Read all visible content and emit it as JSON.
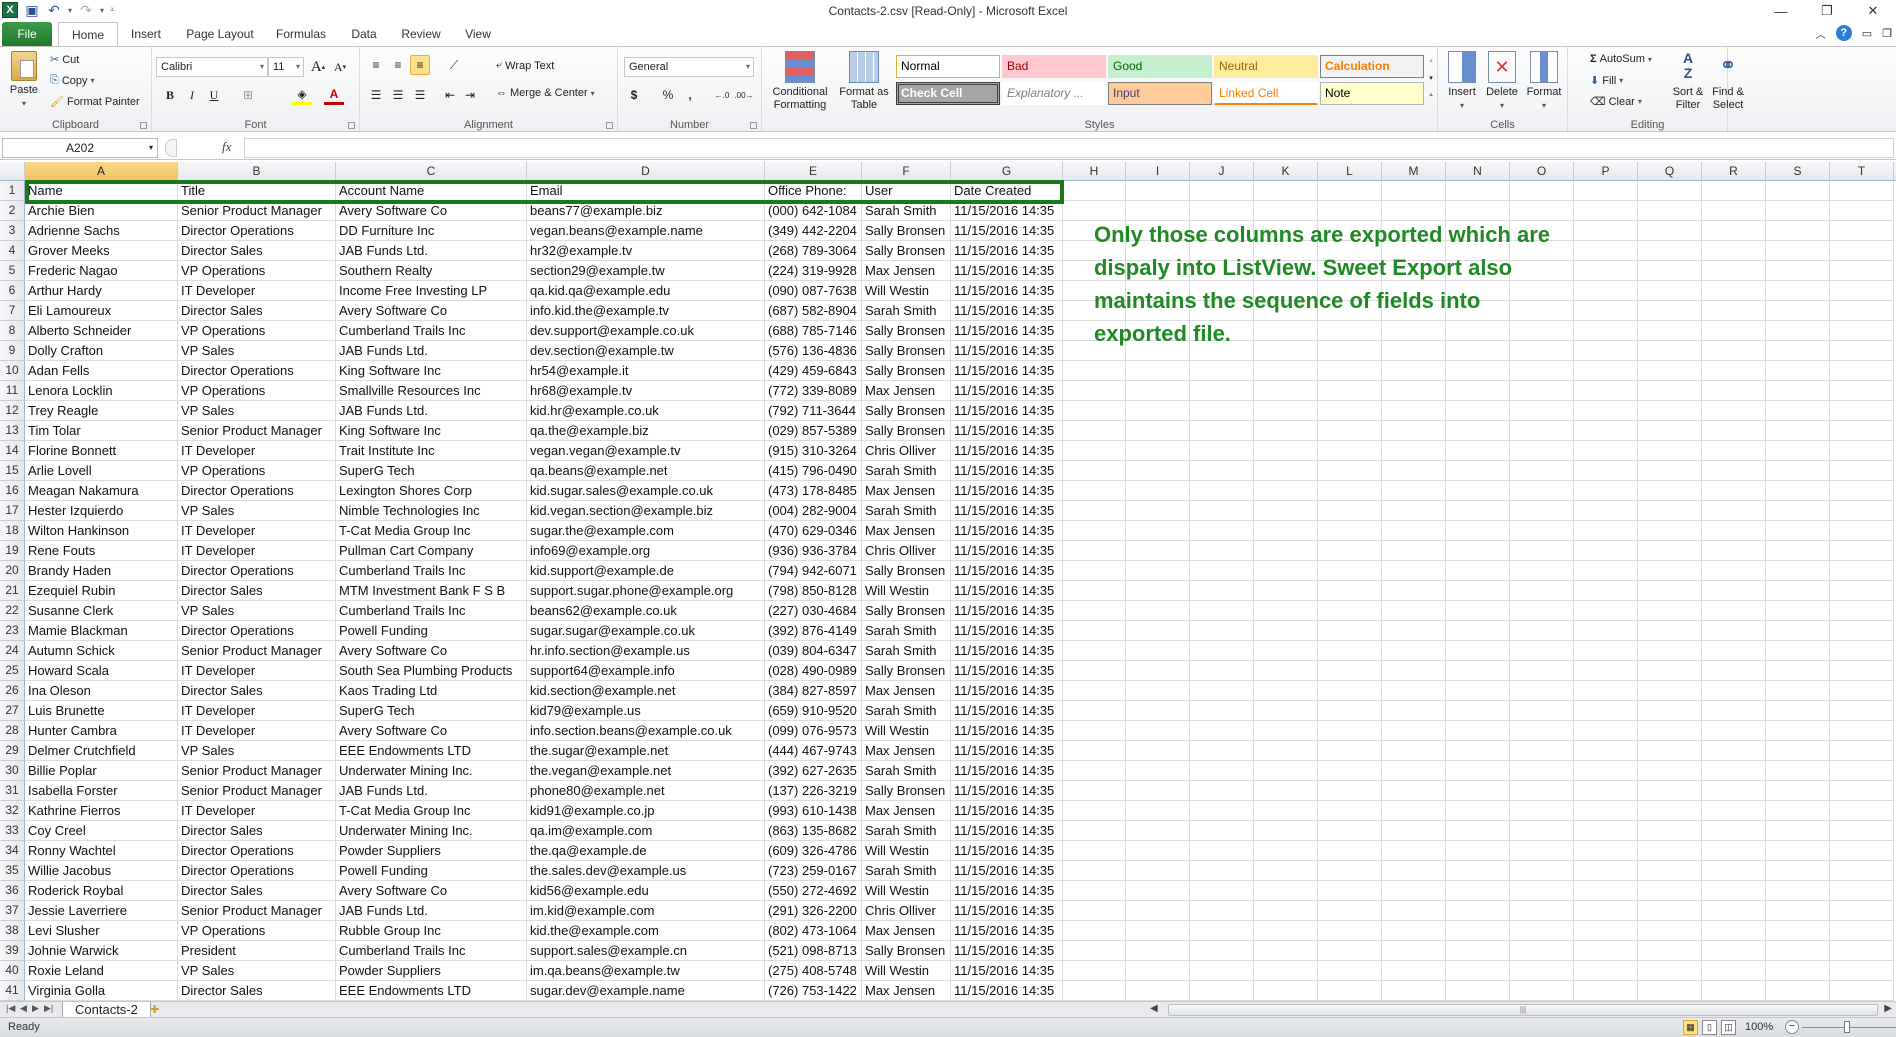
{
  "window": {
    "title": "Contacts-2.csv  [Read-Only]  -  Microsoft Excel",
    "qat": [
      "excel-logo",
      "save-icon",
      "undo-icon",
      "redo-icon",
      "customize-icon"
    ],
    "controls": {
      "minimize": "—",
      "restore": "❐",
      "close": "✕"
    }
  },
  "tabs": [
    {
      "label": "File"
    },
    {
      "label": "Home",
      "active": true
    },
    {
      "label": "Insert"
    },
    {
      "label": "Page Layout"
    },
    {
      "label": "Formulas"
    },
    {
      "label": "Data"
    },
    {
      "label": "Review"
    },
    {
      "label": "View"
    }
  ],
  "ribbon": {
    "clipboard": {
      "label": "Clipboard",
      "paste": "Paste",
      "cut": "Cut",
      "copy": "Copy",
      "format_painter": "Format Painter"
    },
    "font": {
      "label": "Font",
      "font_name": "Calibri",
      "font_size": "11",
      "bold": "B",
      "italic": "I",
      "underline": "U"
    },
    "alignment": {
      "label": "Alignment",
      "wrap_text": "Wrap Text",
      "merge_center": "Merge & Center"
    },
    "number": {
      "label": "Number",
      "format": "General",
      "currency": "$",
      "percent": "%",
      "comma": ","
    },
    "styles": {
      "label": "Styles",
      "conditional_formatting": "Conditional Formatting",
      "format_as_table": "Format as Table",
      "cells": [
        {
          "label": "Normal",
          "bg": "#ffffff",
          "fg": "#000000",
          "border": "#e3b03a"
        },
        {
          "label": "Bad",
          "bg": "#ffc7ce",
          "fg": "#9c0006"
        },
        {
          "label": "Good",
          "bg": "#c6efce",
          "fg": "#006100"
        },
        {
          "label": "Neutral",
          "bg": "#ffeb9c",
          "fg": "#9c6500"
        },
        {
          "label": "Calculation",
          "bg": "#f2f2f2",
          "fg": "#fa7d00",
          "border": "#7f7f7f"
        },
        {
          "label": "Check Cell",
          "bg": "#a5a5a5",
          "fg": "#ffffff",
          "border": "#3f3f3f"
        },
        {
          "label": "Explanatory ...",
          "bg": "#ffffff",
          "fg": "#7f7f7f"
        },
        {
          "label": "Input",
          "bg": "#ffcc99",
          "fg": "#3f3f76",
          "border": "#7f7f7f"
        },
        {
          "label": "Linked Cell",
          "bg": "#ffffff",
          "fg": "#fa7d00"
        },
        {
          "label": "Note",
          "bg": "#ffffcc",
          "fg": "#000000",
          "border": "#b2b2b2"
        }
      ]
    },
    "cells": {
      "label": "Cells",
      "insert": "Insert",
      "delete": "Delete",
      "format": "Format"
    },
    "editing": {
      "label": "Editing",
      "autosum": "AutoSum",
      "fill": "Fill",
      "clear": "Clear",
      "sort_filter": "Sort & Filter",
      "find_select": "Find & Select"
    }
  },
  "formula_bar": {
    "name_box": "A202",
    "fx": "fx",
    "value": ""
  },
  "grid": {
    "columns": [
      "A",
      "B",
      "C",
      "D",
      "E",
      "F",
      "G",
      "H",
      "I",
      "J",
      "K",
      "L",
      "M",
      "N",
      "O",
      "P",
      "Q",
      "R",
      "S",
      "T"
    ],
    "selected_column": "A",
    "header": [
      "Name",
      "Title",
      "Account Name",
      "Email",
      "Office Phone:",
      "User",
      "Date Created"
    ],
    "rows": [
      [
        "Archie Bien",
        "Senior Product Manager",
        "Avery Software Co",
        "beans77@example.biz",
        "(000) 642-1084",
        "Sarah Smith",
        "11/15/2016 14:35"
      ],
      [
        "Adrienne Sachs",
        "Director Operations",
        "DD Furniture Inc",
        "vegan.beans@example.name",
        "(349) 442-2204",
        "Sally Bronsen",
        "11/15/2016 14:35"
      ],
      [
        "Grover Meeks",
        "Director Sales",
        "JAB Funds Ltd.",
        "hr32@example.tv",
        "(268) 789-3064",
        "Sally Bronsen",
        "11/15/2016 14:35"
      ],
      [
        "Frederic Nagao",
        "VP Operations",
        "Southern Realty",
        "section29@example.tw",
        "(224) 319-9928",
        "Max Jensen",
        "11/15/2016 14:35"
      ],
      [
        "Arthur Hardy",
        "IT Developer",
        "Income Free Investing LP",
        "qa.kid.qa@example.edu",
        "(090) 087-7638",
        "Will Westin",
        "11/15/2016 14:35"
      ],
      [
        "Eli Lamoureux",
        "Director Sales",
        "Avery Software Co",
        "info.kid.the@example.tv",
        "(687) 582-8904",
        "Sarah Smith",
        "11/15/2016 14:35"
      ],
      [
        "Alberto Schneider",
        "VP Operations",
        "Cumberland Trails Inc",
        "dev.support@example.co.uk",
        "(688) 785-7146",
        "Sally Bronsen",
        "11/15/2016 14:35"
      ],
      [
        "Dolly Crafton",
        "VP Sales",
        "JAB Funds Ltd.",
        "dev.section@example.tw",
        "(576) 136-4836",
        "Sally Bronsen",
        "11/15/2016 14:35"
      ],
      [
        "Adan Fells",
        "Director Operations",
        "King Software Inc",
        "hr54@example.it",
        "(429) 459-6843",
        "Sally Bronsen",
        "11/15/2016 14:35"
      ],
      [
        "Lenora Locklin",
        "VP Operations",
        "Smallville Resources Inc",
        "hr68@example.tv",
        "(772) 339-8089",
        "Max Jensen",
        "11/15/2016 14:35"
      ],
      [
        "Trey Reagle",
        "VP Sales",
        "JAB Funds Ltd.",
        "kid.hr@example.co.uk",
        "(792) 711-3644",
        "Sally Bronsen",
        "11/15/2016 14:35"
      ],
      [
        "Tim Tolar",
        "Senior Product Manager",
        "King Software Inc",
        "qa.the@example.biz",
        "(029) 857-5389",
        "Sally Bronsen",
        "11/15/2016 14:35"
      ],
      [
        "Florine Bonnett",
        "IT Developer",
        "Trait Institute Inc",
        "vegan.vegan@example.tv",
        "(915) 310-3264",
        "Chris Olliver",
        "11/15/2016 14:35"
      ],
      [
        "Arlie Lovell",
        "VP Operations",
        "SuperG Tech",
        "qa.beans@example.net",
        "(415) 796-0490",
        "Sarah Smith",
        "11/15/2016 14:35"
      ],
      [
        "Meagan Nakamura",
        "Director Operations",
        "Lexington Shores Corp",
        "kid.sugar.sales@example.co.uk",
        "(473) 178-8485",
        "Max Jensen",
        "11/15/2016 14:35"
      ],
      [
        "Hester Izquierdo",
        "VP Sales",
        "Nimble Technologies Inc",
        "kid.vegan.section@example.biz",
        "(004) 282-9004",
        "Sarah Smith",
        "11/15/2016 14:35"
      ],
      [
        "Wilton Hankinson",
        "IT Developer",
        "T-Cat Media Group Inc",
        "sugar.the@example.com",
        "(470) 629-0346",
        "Max Jensen",
        "11/15/2016 14:35"
      ],
      [
        "Rene Fouts",
        "IT Developer",
        "Pullman Cart Company",
        "info69@example.org",
        "(936) 936-3784",
        "Chris Olliver",
        "11/15/2016 14:35"
      ],
      [
        "Brandy Haden",
        "Director Operations",
        "Cumberland Trails Inc",
        "kid.support@example.de",
        "(794) 942-6071",
        "Sally Bronsen",
        "11/15/2016 14:35"
      ],
      [
        "Ezequiel Rubin",
        "Director Sales",
        "MTM Investment Bank F S B",
        "support.sugar.phone@example.org",
        "(798) 850-8128",
        "Will Westin",
        "11/15/2016 14:35"
      ],
      [
        "Susanne Clerk",
        "VP Sales",
        "Cumberland Trails Inc",
        "beans62@example.co.uk",
        "(227) 030-4684",
        "Sally Bronsen",
        "11/15/2016 14:35"
      ],
      [
        "Mamie Blackman",
        "Director Operations",
        "Powell Funding",
        "sugar.sugar@example.co.uk",
        "(392) 876-4149",
        "Sarah Smith",
        "11/15/2016 14:35"
      ],
      [
        "Autumn Schick",
        "Senior Product Manager",
        "Avery Software Co",
        "hr.info.section@example.us",
        "(039) 804-6347",
        "Sarah Smith",
        "11/15/2016 14:35"
      ],
      [
        "Howard Scala",
        "IT Developer",
        "South Sea Plumbing Products",
        "support64@example.info",
        "(028) 490-0989",
        "Sally Bronsen",
        "11/15/2016 14:35"
      ],
      [
        "Ina Oleson",
        "Director Sales",
        "Kaos Trading Ltd",
        "kid.section@example.net",
        "(384) 827-8597",
        "Max Jensen",
        "11/15/2016 14:35"
      ],
      [
        "Luis Brunette",
        "IT Developer",
        "SuperG Tech",
        "kid79@example.us",
        "(659) 910-9520",
        "Sarah Smith",
        "11/15/2016 14:35"
      ],
      [
        "Hunter Cambra",
        "IT Developer",
        "Avery Software Co",
        "info.section.beans@example.co.uk",
        "(099) 076-9573",
        "Will Westin",
        "11/15/2016 14:35"
      ],
      [
        "Delmer Crutchfield",
        "VP Sales",
        "EEE Endowments LTD",
        "the.sugar@example.net",
        "(444) 467-9743",
        "Max Jensen",
        "11/15/2016 14:35"
      ],
      [
        "Billie Poplar",
        "Senior Product Manager",
        "Underwater Mining Inc.",
        "the.vegan@example.net",
        "(392) 627-2635",
        "Sarah Smith",
        "11/15/2016 14:35"
      ],
      [
        "Isabella Forster",
        "Senior Product Manager",
        "JAB Funds Ltd.",
        "phone80@example.net",
        "(137) 226-3219",
        "Sally Bronsen",
        "11/15/2016 14:35"
      ],
      [
        "Kathrine Fierros",
        "IT Developer",
        "T-Cat Media Group Inc",
        "kid91@example.co.jp",
        "(993) 610-1438",
        "Max Jensen",
        "11/15/2016 14:35"
      ],
      [
        "Coy Creel",
        "Director Sales",
        "Underwater Mining Inc.",
        "qa.im@example.com",
        "(863) 135-8682",
        "Sarah Smith",
        "11/15/2016 14:35"
      ],
      [
        "Ronny Wachtel",
        "Director Operations",
        "Powder Suppliers",
        "the.qa@example.de",
        "(609) 326-4786",
        "Will Westin",
        "11/15/2016 14:35"
      ],
      [
        "Willie Jacobus",
        "Director Operations",
        "Powell Funding",
        "the.sales.dev@example.us",
        "(723) 259-0167",
        "Sarah Smith",
        "11/15/2016 14:35"
      ],
      [
        "Roderick Roybal",
        "Director Sales",
        "Avery Software Co",
        "kid56@example.edu",
        "(550) 272-4692",
        "Will Westin",
        "11/15/2016 14:35"
      ],
      [
        "Jessie Laverriere",
        "Senior Product Manager",
        "JAB Funds Ltd.",
        "im.kid@example.com",
        "(291) 326-2200",
        "Chris Olliver",
        "11/15/2016 14:35"
      ],
      [
        "Levi Slusher",
        "VP Operations",
        "Rubble Group Inc",
        "kid.the@example.com",
        "(802) 473-1064",
        "Max Jensen",
        "11/15/2016 14:35"
      ],
      [
        "Johnie Warwick",
        "President",
        "Cumberland Trails Inc",
        "support.sales@example.cn",
        "(521) 098-8713",
        "Sally Bronsen",
        "11/15/2016 14:35"
      ],
      [
        "Roxie Leland",
        "VP Sales",
        "Powder Suppliers",
        "im.qa.beans@example.tw",
        "(275) 408-5748",
        "Will Westin",
        "11/15/2016 14:35"
      ],
      [
        "Virginia Golla",
        "Director Sales",
        "EEE Endowments LTD",
        "sugar.dev@example.name",
        "(726) 753-1422",
        "Max Jensen",
        "11/15/2016 14:35"
      ]
    ]
  },
  "annotation": {
    "text": "Only those columns are exported which are dispaly into ListView. Sweet Export also maintains the sequence of fields into exported file.",
    "color": "#1f8a24",
    "highlight_color": "#1a7a1a"
  },
  "sheet_tabs": {
    "active": "Contacts-2"
  },
  "status_bar": {
    "mode": "Ready",
    "zoom": "100%"
  }
}
